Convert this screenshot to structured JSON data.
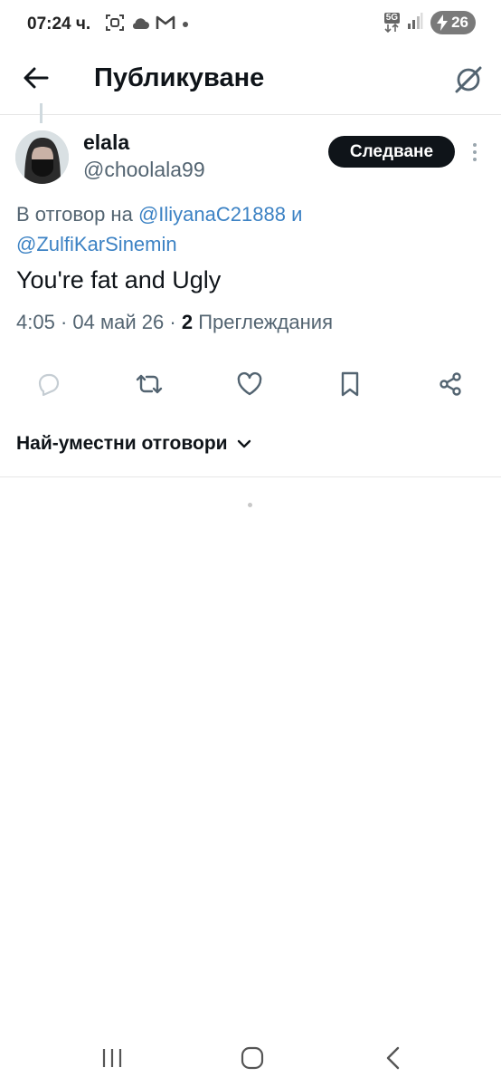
{
  "status_bar": {
    "time": "07:24 ч.",
    "network": "5G",
    "battery": "26"
  },
  "header": {
    "title": "Публикуване"
  },
  "tweet": {
    "author_name": "elala",
    "author_handle": "@choolala99",
    "follow_label": "Следване",
    "reply_prefix": "В отговор на",
    "reply_mention_1": "@IliyanaC21888",
    "reply_conjunction": "и",
    "reply_mention_2": "@ZulfiKarSinemin",
    "text": "You're fat and Ugly",
    "time": "4:05",
    "date": "04 май 26",
    "views_count": "2",
    "views_label": "Преглеждания"
  },
  "actions": [
    "reply-icon",
    "retweet-icon",
    "like-icon",
    "bookmark-icon",
    "share-icon"
  ],
  "replies_sort": {
    "label": "Най-уместни отговори"
  },
  "colors": {
    "accent": "#3c82c4",
    "follow_bg": "#0f1419",
    "secondary_text": "#536471"
  }
}
